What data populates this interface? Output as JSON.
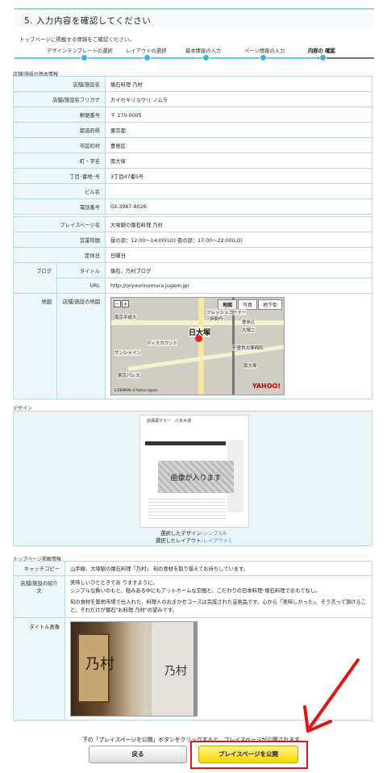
{
  "header": {
    "step_title": "5. 入力内容を確認してください",
    "subtitle": "トップページに掲載する情報をご確認ください。"
  },
  "progress": {
    "steps": [
      "デザインテンプレートの選択",
      "レイアウトの選択",
      "基本情報の入力",
      "ページ情報の入力",
      "内容の 確認"
    ],
    "current_index": 4
  },
  "basic_info": {
    "section_label": "店舗/施設の基本情報",
    "rows": [
      {
        "label": "店舗/施設名",
        "value": "懐石料理 乃村"
      },
      {
        "label": "店舗/施設名フリガナ",
        "value": "カイセキリョウリ ノムラ"
      },
      {
        "label": "郵便番号",
        "value": "〒 170-0005"
      },
      {
        "label": "都道府県",
        "value": "東京都"
      },
      {
        "label": "市区町村",
        "value": "豊島区"
      },
      {
        "label": "町・字名",
        "value": "南大塚"
      },
      {
        "label": "丁目･番地･号",
        "value": "3丁目47番5号"
      },
      {
        "label": "ビル名",
        "value": ""
      },
      {
        "label": "電話番号",
        "value": "03-3987-8026"
      }
    ]
  },
  "place_info": {
    "page_name_label": "プレイスページ名",
    "page_name": "大塚駅の懐石料理 乃村",
    "hours_label": "営業時間",
    "hours": "昼の部：12:00～14:00(LO) 夜の部：17:00～22:00(LO)",
    "holiday_label": "定休日",
    "holiday": "日曜日",
    "blog_label": "ブログ",
    "blog_title_label": "タイトル",
    "blog_title": "懐石、乃村ブログ",
    "blog_url_label": "URL",
    "blog_url": "http://oryourinomura.jugem.jp/",
    "map_label": "地図",
    "map_sub_label": "店舗/施設の地図",
    "map": {
      "tabs": [
        "地図",
        "写真",
        "地下街"
      ],
      "station_label": "日大塚",
      "place_labels": [
        "フレッシュコーナー",
        "伊勢丹",
        "南京平成大",
        "豊島区",
        "大塚二",
        "ディスカウント",
        "サンシャイン",
        "東京パレス",
        "千登世大塚病院",
        "南大塚"
      ],
      "brand": "YAHOO!",
      "copyright": "©ZENRIN ©Yahoo Japan"
    }
  },
  "design": {
    "section_label": "デザイン",
    "preview_header": "創講蔵サラー　六本木通",
    "preview_image_text": "画像が入ります",
    "selected_design_label": "選択したデザイン:",
    "selected_design": "シンプル6",
    "selected_layout_label": "選択したレイアウト:",
    "selected_layout": "レイアウト1"
  },
  "top_info": {
    "section_label": "トップページ掲載情報",
    "catchcopy_label": "キャッチコピー",
    "catchcopy": "山手線、大塚駅の懐石料理「乃村」 旬の食材を取り揃えてお待ちしています。",
    "intro_label": "店舗/施設の紹介文",
    "intro_lines": [
      "美味しいひとときであ りますように。",
      "シンプルな飾いのもと、穏みある中にもアットホームな空間と、こだわりの日本料理･懐石料理でおもてなし。",
      "",
      "旬の食材を築地市場で仕入れた、料理人のおまかせコースは完成された芸術品です。心から「美味しかった」、そう言って頂けること、それだけが懐石\"お料理 乃村\"の望みです。"
    ],
    "title_image_label": "タイトル画像",
    "photo_kanji": [
      "乃村",
      "乃村"
    ]
  },
  "footer": {
    "notice": "下の「プレイスページを公開」ボタンをクリックすると、プレイスページが公開されます。",
    "back_label": "戻る",
    "publish_label": "プレイスページを公開"
  },
  "colors": {
    "accent": "#3fb4d8",
    "publish_button": "#f5d800",
    "highlight_frame": "#e01414",
    "table_border": "#b9d9e4"
  }
}
